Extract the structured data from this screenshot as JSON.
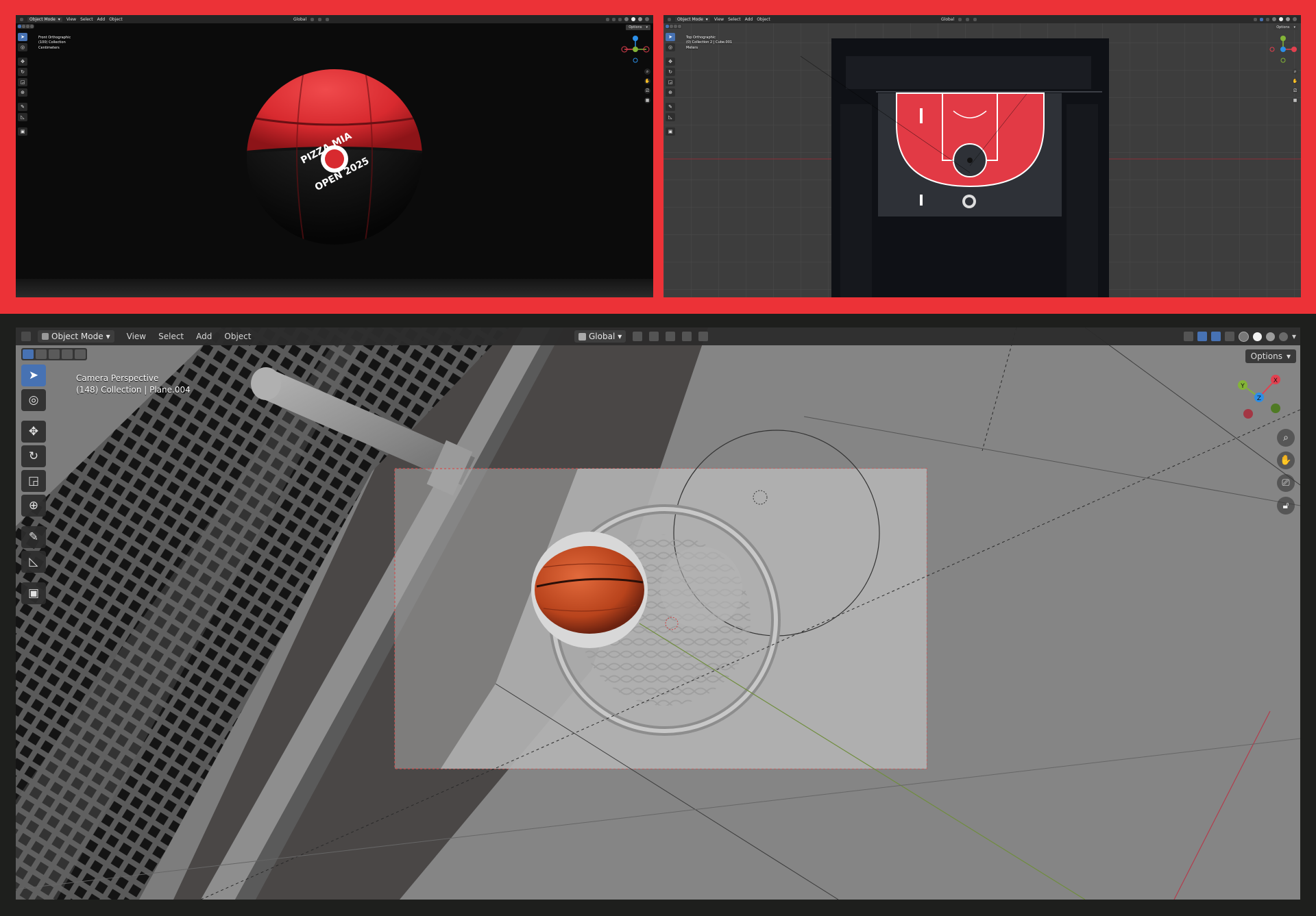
{
  "top_left_viewport": {
    "header": {
      "mode": "Object Mode",
      "menus": [
        "View",
        "Select",
        "Add",
        "Object"
      ],
      "orientation": "Global",
      "options": "Options"
    },
    "info": {
      "view": "Front Orthographic",
      "collection": "(100) Collection",
      "units": "Centimeters"
    },
    "logo": {
      "line1": "PIZZA MIA",
      "line2": "OPEN 2025"
    }
  },
  "top_right_viewport": {
    "header": {
      "mode": "Object Mode",
      "menus": [
        "View",
        "Select",
        "Add",
        "Object"
      ],
      "orientation": "Global",
      "options": "Options"
    },
    "info": {
      "view": "Top Orthographic",
      "collection": "(0) Collection 2 | Cube.001",
      "units": "Meters"
    }
  },
  "main_viewport": {
    "header": {
      "mode": "Object Mode",
      "menus": [
        "View",
        "Select",
        "Add",
        "Object"
      ],
      "orientation": "Global",
      "options": "Options"
    },
    "info": {
      "view": "Camera Perspective",
      "collection": "(148) Collection | Plane.004"
    },
    "gizmo": {
      "x": "X",
      "y": "Y",
      "z": "Z"
    }
  },
  "colors": {
    "frame_red": "#ec3237",
    "header": "#2b2b2b",
    "active_tool": "#4772b3",
    "axis_x": "#e2404f",
    "axis_y": "#83b437",
    "axis_z": "#2c8fe8"
  },
  "icons": [
    "cursor-icon",
    "cursor3d-icon",
    "move-icon",
    "rotate-icon",
    "scale-icon",
    "transform-icon",
    "annotate-icon",
    "measure-icon",
    "add-cube-icon",
    "zoom-icon",
    "hand-icon",
    "camera-icon",
    "lock-icon"
  ]
}
